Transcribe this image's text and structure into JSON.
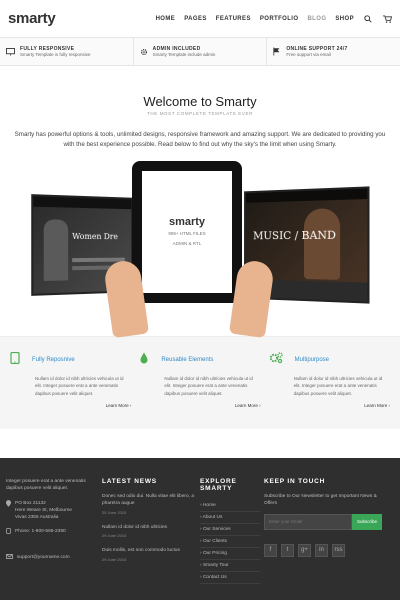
{
  "header": {
    "logo": "smarty",
    "nav": [
      "HOME",
      "PAGES",
      "FEATURES",
      "PORTFOLIO",
      "BLOG",
      "SHOP"
    ]
  },
  "features": [
    {
      "title": "FULLY RESPONSIVE",
      "sub": "Smarty Template is fully responsive",
      "icon": "monitor-icon"
    },
    {
      "title": "ADMIN INCLUDED",
      "sub": "Smarty Template include admin",
      "icon": "gear-icon"
    },
    {
      "title": "ONLINE SUPPORT 24/7",
      "sub": "Free support via email",
      "icon": "flag-icon"
    }
  ],
  "welcome": {
    "title": "Welcome to Smarty",
    "tagline": "THE MOST COMPLETE TEMPLATE EVER",
    "intro": "Smarty has powerful options & tools, unlimited designs, responsive framework and amazing support. We are dedicated to providing you with the best experience possible. Read below to find out why the sky's the limit when using Smarty."
  },
  "hero": {
    "tablet_brand": "smarty",
    "tablet_line1": "999+ HTML FILES",
    "tablet_line2": "ADMIN & RTL",
    "left_screen": "Women Dre",
    "right_screen": "MUSIC / BAND"
  },
  "services": [
    {
      "title": "Fully Reposnive",
      "text": "Nullam id dolor id nibh ultricies vehicula ut id elit. Integer posuere erat a ante venenatis dapibus posuere velit aliquet.",
      "link": "Learn More",
      "icon": "mobile-icon",
      "color": "#4caf50"
    },
    {
      "title": "Reusable Elements",
      "text": "Nullam id dolor id nibh ultricies vehicula ut id elit. Integer posuere erat a ante venenatis dapibus posuere velit aliquet.",
      "link": "Learn More",
      "icon": "drop-icon",
      "color": "#4caf50"
    },
    {
      "title": "Multipurpose",
      "text": "Nullam id dolor id nibh ultricies vehicula ut id elit. Integer posuere erat a ante venenatis dapibus posuere velit aliquet.",
      "link": "Learn More",
      "icon": "gears-icon",
      "color": "#4caf50"
    }
  ],
  "footer": {
    "about": "Integer posuere erat a ante venenatis dapibus posuere velit aliquet.",
    "address": "PO Box 21132\nHere Weare St, Melbourne\nVivas 2355 Australia",
    "phone": "Phone: 1-800-565-2390",
    "email": "support@yourname.com",
    "news_title": "LATEST NEWS",
    "news": [
      {
        "text": "Donec sed odio dui. Nulla vitae elit libero, a pharetra augue",
        "date": "29 June 2015"
      },
      {
        "text": "Nullam id dolor id nibh ultricies",
        "date": "29 June 2015"
      },
      {
        "text": "Duis mollis, est non commodo luctus",
        "date": "29 June 2015"
      }
    ],
    "explore_title": "EXPLORE SMARTY",
    "explore": [
      "Home",
      "About Us",
      "Our Services",
      "Our Clients",
      "Our Pricing",
      "Smarty Tour",
      "Contact Us"
    ],
    "touch_title": "KEEP IN TOUCH",
    "touch_text": "Subscribe to Our Newsletter to get Important News & Offers",
    "input_placeholder": "Enter your Email",
    "subscribe": "Subscribe",
    "social": [
      "f",
      "t",
      "g+",
      "in",
      "rss"
    ]
  },
  "colors": {
    "accent": "#2d8bc9",
    "green": "#3aa657",
    "footer_bg": "#2f2f2f"
  }
}
